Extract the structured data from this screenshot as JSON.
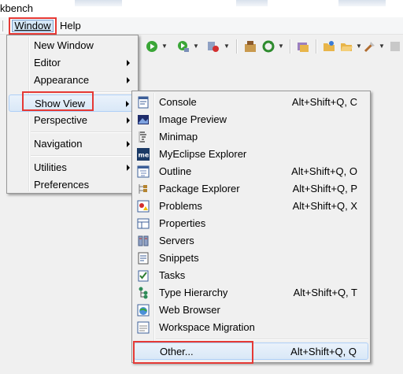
{
  "window_title": "kbench",
  "menubar": {
    "items": [
      {
        "id": "window",
        "label": "Window"
      },
      {
        "id": "help",
        "label": "Help"
      }
    ]
  },
  "window_menu": {
    "items": [
      {
        "label": "New Window",
        "submenu": false
      },
      {
        "label": "Editor",
        "submenu": true
      },
      {
        "label": "Appearance",
        "submenu": true
      },
      {
        "label": "Show View",
        "submenu": true,
        "highlighted": true
      },
      {
        "label": "Perspective",
        "submenu": true
      },
      {
        "label": "Navigation",
        "submenu": true
      },
      {
        "label": "Utilities",
        "submenu": true
      },
      {
        "label": "Preferences",
        "submenu": false
      }
    ]
  },
  "show_view_menu": {
    "items": [
      {
        "label": "Console",
        "accel": "Alt+Shift+Q, C",
        "icon": "console-icon"
      },
      {
        "label": "Image Preview",
        "accel": "",
        "icon": "image-preview-icon"
      },
      {
        "label": "Minimap",
        "accel": "",
        "icon": "minimap-icon"
      },
      {
        "label": "MyEclipse Explorer",
        "accel": "",
        "icon": "myeclipse-icon"
      },
      {
        "label": "Outline",
        "accel": "Alt+Shift+Q, O",
        "icon": "outline-icon"
      },
      {
        "label": "Package Explorer",
        "accel": "Alt+Shift+Q, P",
        "icon": "package-explorer-icon"
      },
      {
        "label": "Problems",
        "accel": "Alt+Shift+Q, X",
        "icon": "problems-icon"
      },
      {
        "label": "Properties",
        "accel": "",
        "icon": "properties-icon"
      },
      {
        "label": "Servers",
        "accel": "",
        "icon": "servers-icon"
      },
      {
        "label": "Snippets",
        "accel": "",
        "icon": "snippets-icon"
      },
      {
        "label": "Tasks",
        "accel": "",
        "icon": "tasks-icon"
      },
      {
        "label": "Type Hierarchy",
        "accel": "Alt+Shift+Q, T",
        "icon": "type-hierarchy-icon"
      },
      {
        "label": "Web Browser",
        "accel": "",
        "icon": "web-browser-icon"
      },
      {
        "label": "Workspace Migration",
        "accel": "",
        "icon": "workspace-migration-icon"
      },
      {
        "label": "Other...",
        "accel": "Alt+Shift+Q, Q",
        "icon": "",
        "highlighted": true
      }
    ]
  },
  "colors": {
    "annotation_red": "#e53935",
    "highlight_border": "#aecff7",
    "menu_background": "#f0f0f0"
  }
}
